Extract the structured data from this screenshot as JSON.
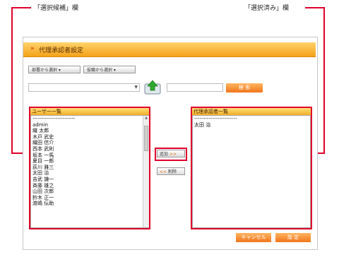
{
  "callouts": {
    "candidates": "「選択候補」欄",
    "selected": "「選択済み」欄"
  },
  "panel": {
    "title": "代理承認者設定"
  },
  "filters": {
    "by_department": "部署から選択",
    "by_position": "役職から選択"
  },
  "search": {
    "select_value": "",
    "input_value": "",
    "button": "検 索"
  },
  "user_list": {
    "header": "ユーザー一覧",
    "items": [
      "------------------------",
      "admin",
      "織 太郎",
      "木戸 武史",
      "織田 信介",
      "西本 武則",
      "坂本 一馬",
      "夏目 一郎",
      "荻川 雅三",
      "太田 治",
      "吉武 謙一",
      "斉藤 雄之",
      "山田 次郎",
      "鈴木 正一",
      "渡嶋 伝助"
    ]
  },
  "approver_list": {
    "header": "代理承認者一覧",
    "items": [
      "------------------------",
      "太田 治"
    ]
  },
  "actions": {
    "add": "追加",
    "add_arrow": ">>",
    "remove_arrow": "<<",
    "remove": "削除"
  },
  "footer": {
    "cancel": "キャンセル",
    "ok": "設 定"
  },
  "colors": {
    "accent_red": "#e0002a",
    "orange": "#f0761c",
    "header_gold": "#f4a21a"
  },
  "icons": {
    "title_arrow": "chevron-right-icon",
    "upload": "folder-up-icon"
  }
}
